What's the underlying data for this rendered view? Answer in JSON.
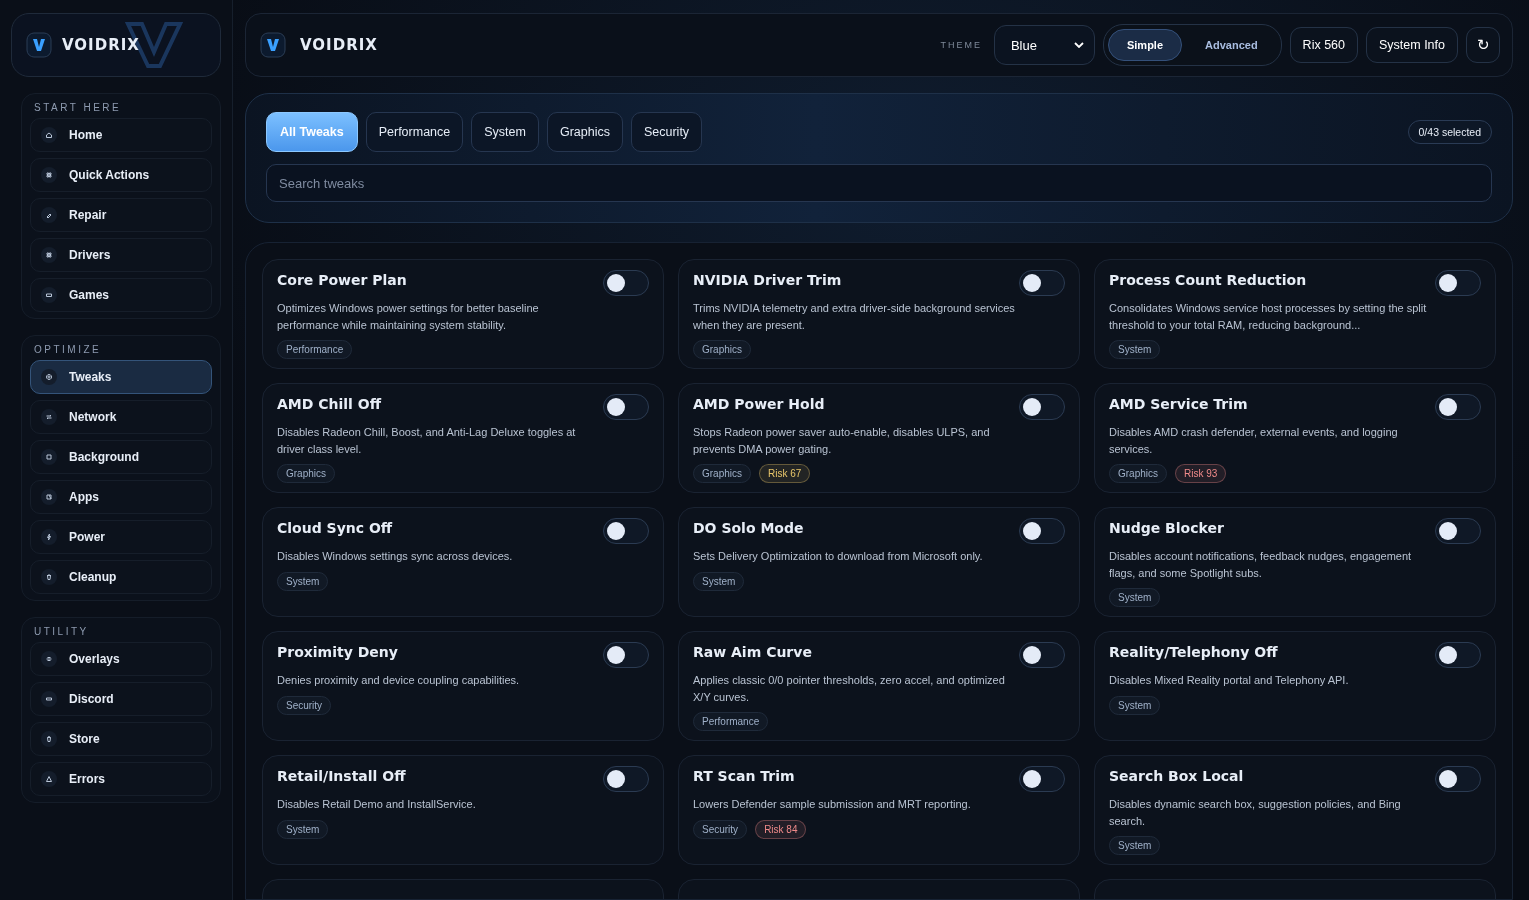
{
  "sidebar": {
    "brand": "VOIDRIX",
    "sections": [
      {
        "title": "START HERE",
        "items": [
          {
            "label": "Home",
            "selected": false
          },
          {
            "label": "Quick Actions",
            "selected": false
          },
          {
            "label": "Repair",
            "selected": false
          },
          {
            "label": "Drivers",
            "selected": false
          },
          {
            "label": "Games",
            "selected": false
          }
        ]
      },
      {
        "title": "OPTIMIZE",
        "items": [
          {
            "label": "Tweaks",
            "selected": true
          },
          {
            "label": "Network",
            "selected": false
          },
          {
            "label": "Background",
            "selected": false
          },
          {
            "label": "Apps",
            "selected": false
          },
          {
            "label": "Power",
            "selected": false
          },
          {
            "label": "Cleanup",
            "selected": false
          }
        ]
      },
      {
        "title": "UTILITY",
        "items": [
          {
            "label": "Overlays",
            "selected": false
          },
          {
            "label": "Discord",
            "selected": false
          },
          {
            "label": "Store",
            "selected": false
          },
          {
            "label": "Errors",
            "selected": false
          }
        ]
      }
    ]
  },
  "header": {
    "brand": "VOIDRIX",
    "theme_label": "THEME",
    "theme_value": "Blue",
    "modes": [
      {
        "label": "Simple",
        "selected": true
      },
      {
        "label": "Advanced",
        "selected": false
      }
    ],
    "buttons": [
      "Rix 560",
      "System Info"
    ],
    "refresh": "↻"
  },
  "filters": {
    "tabs": [
      {
        "label": "All Tweaks",
        "selected": true
      },
      {
        "label": "Performance",
        "selected": false
      },
      {
        "label": "System",
        "selected": false
      },
      {
        "label": "Graphics",
        "selected": false
      },
      {
        "label": "Security",
        "selected": false
      }
    ],
    "selected_count": "0/43 selected",
    "search": {
      "placeholder": "Search tweaks"
    }
  },
  "tweaks": [
    {
      "title": "Core Power Plan",
      "description": "Optimizes Windows power settings for better baseline performance while maintaining system stability.",
      "on": false,
      "tags": [
        {
          "kind": "category",
          "label": "Performance"
        }
      ]
    },
    {
      "title": "NVIDIA Driver Trim",
      "description": "Trims NVIDIA telemetry and extra driver-side background services when they are present.",
      "on": false,
      "tags": [
        {
          "kind": "category",
          "label": "Graphics"
        }
      ]
    },
    {
      "title": "Process Count Reduction",
      "description": "Consolidates Windows service host processes by setting the split threshold to your total RAM, reducing background...",
      "on": false,
      "tags": [
        {
          "kind": "category",
          "label": "System"
        }
      ]
    },
    {
      "title": "AMD Chill Off",
      "description": "Disables Radeon Chill, Boost, and Anti-Lag Deluxe toggles at driver class level.",
      "on": false,
      "tags": [
        {
          "kind": "category",
          "label": "Graphics"
        }
      ]
    },
    {
      "title": "AMD Power Hold",
      "description": "Stops Radeon power saver auto-enable, disables ULPS, and prevents DMA power gating.",
      "on": false,
      "tags": [
        {
          "kind": "category",
          "label": "Graphics"
        },
        {
          "kind": "risk",
          "label": "Risk 67",
          "color": "#e8c66a"
        }
      ]
    },
    {
      "title": "AMD Service Trim",
      "description": "Disables AMD crash defender, external events, and logging services.",
      "on": false,
      "tags": [
        {
          "kind": "category",
          "label": "Graphics"
        },
        {
          "kind": "risk",
          "label": "Risk 93",
          "color": "#f08a8a"
        }
      ]
    },
    {
      "title": "Cloud Sync Off",
      "description": "Disables Windows settings sync across devices.",
      "on": false,
      "tags": [
        {
          "kind": "category",
          "label": "System"
        }
      ]
    },
    {
      "title": "DO Solo Mode",
      "description": "Sets Delivery Optimization to download from Microsoft only.",
      "on": false,
      "tags": [
        {
          "kind": "category",
          "label": "System"
        }
      ]
    },
    {
      "title": "Nudge Blocker",
      "description": "Disables account notifications, feedback nudges, engagement flags, and some Spotlight subs.",
      "on": false,
      "tags": [
        {
          "kind": "category",
          "label": "System"
        }
      ]
    },
    {
      "title": "Proximity Deny",
      "description": "Denies proximity and device coupling capabilities.",
      "on": false,
      "tags": [
        {
          "kind": "category",
          "label": "Security"
        }
      ]
    },
    {
      "title": "Raw Aim Curve",
      "description": "Applies classic 0/0 pointer thresholds, zero accel, and optimized X/Y curves.",
      "on": false,
      "tags": [
        {
          "kind": "category",
          "label": "Performance"
        }
      ]
    },
    {
      "title": "Reality/Telephony Off",
      "description": "Disables Mixed Reality portal and Telephony API.",
      "on": false,
      "tags": [
        {
          "kind": "category",
          "label": "System"
        }
      ]
    },
    {
      "title": "Retail/Install Off",
      "description": "Disables Retail Demo and InstallService.",
      "on": false,
      "tags": [
        {
          "kind": "category",
          "label": "System"
        }
      ]
    },
    {
      "title": "RT Scan Trim",
      "description": "Lowers Defender sample submission and MRT reporting.",
      "on": false,
      "tags": [
        {
          "kind": "category",
          "label": "Security"
        },
        {
          "kind": "risk",
          "label": "Risk 84",
          "color": "#f08a8a"
        }
      ]
    },
    {
      "title": "Search Box Local",
      "description": "Disables dynamic search box, suggestion policies, and Bing search.",
      "on": false,
      "tags": [
        {
          "kind": "category",
          "label": "System"
        }
      ]
    }
  ]
}
